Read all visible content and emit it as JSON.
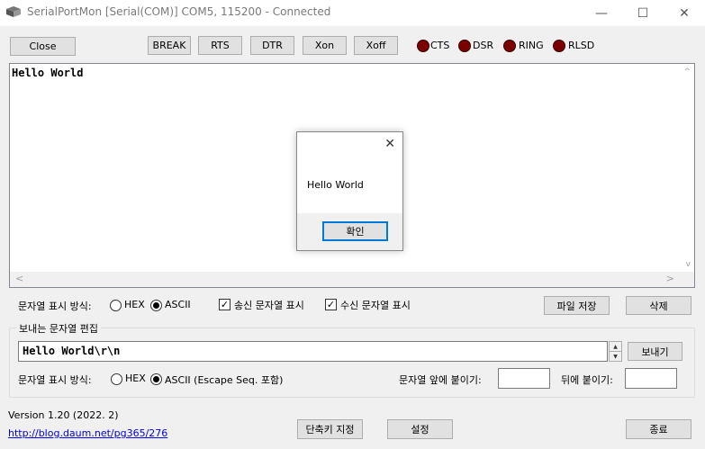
{
  "window": {
    "title": "SerialPortMon [Serial(COM)] COM5, 115200 - Connected",
    "minimize_glyph": "—",
    "maximize_glyph": "☐",
    "close_glyph": "✕"
  },
  "toolbar": {
    "close_label": "Close",
    "break_label": "BREAK",
    "rts_label": "RTS",
    "dtr_label": "DTR",
    "xon_label": "Xon",
    "xoff_label": "Xoff",
    "leds": [
      {
        "label": "CTS",
        "color": "#7a0000"
      },
      {
        "label": "DSR",
        "color": "#7a0000"
      },
      {
        "label": "RING",
        "color": "#7a0000"
      },
      {
        "label": "RLSD",
        "color": "#7a0000"
      }
    ]
  },
  "receive": {
    "text": "Hello World",
    "scroll_left": "<",
    "scroll_right": ">",
    "scroll_up": "^",
    "scroll_down": "v"
  },
  "dialog": {
    "message": "Hello World",
    "ok_label": "확인",
    "close_glyph": "✕"
  },
  "display_options": {
    "label": "문자열 표시 방식:",
    "hex_label": "HEX",
    "ascii_label": "ASCII",
    "selected": "ASCII",
    "show_sent_label": "송신 문자열 표시",
    "show_sent_checked": true,
    "show_recv_label": "수신 문자열 표시",
    "show_recv_checked": true,
    "save_file_label": "파일 저장",
    "delete_label": "삭제"
  },
  "send_group": {
    "title": "보내는 문자열 편집",
    "input_value": "Hello World\\r\\n",
    "send_label": "보내기",
    "format_label": "문자열 표시 방식:",
    "hex_label": "HEX",
    "ascii_label": "ASCII (Escape Seq. 포함)",
    "selected": "ASCII",
    "prefix_label": "문자열 앞에 붙이기:",
    "prefix_value": "",
    "suffix_label": "뒤에 붙이기:",
    "suffix_value": ""
  },
  "footer": {
    "version": "Version 1.20 (2022. 2)",
    "link": "http://blog.daum.net/pg365/276",
    "shortcut_label": "단축키 지정",
    "settings_label": "설정",
    "exit_label": "종료"
  }
}
